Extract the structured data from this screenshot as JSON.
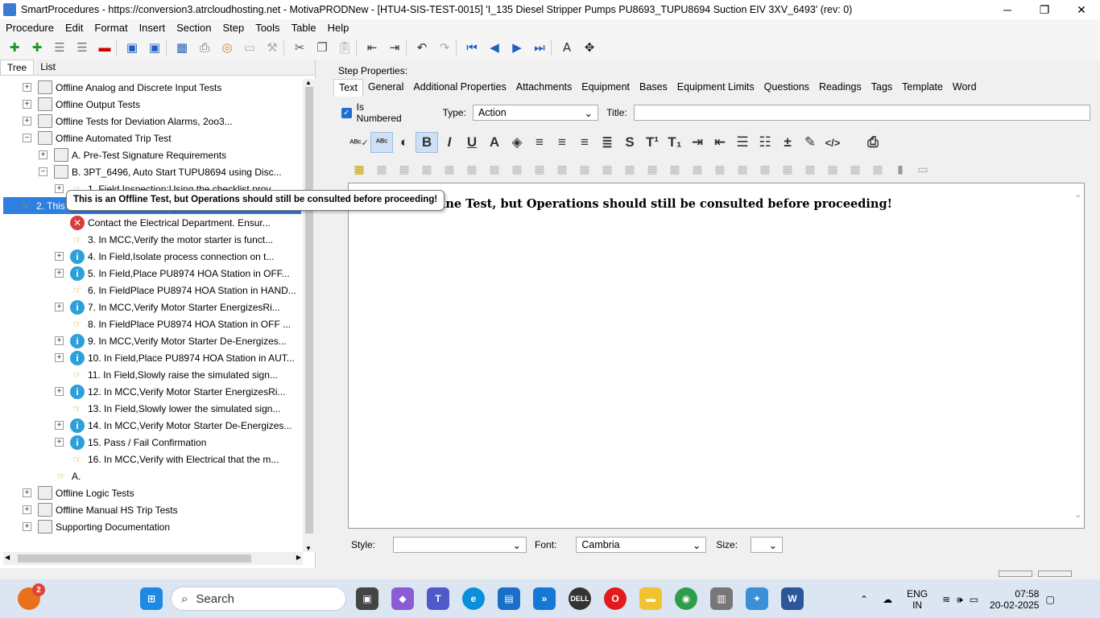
{
  "window": {
    "title": "SmartProcedures - https://conversion3.atrcloudhosting.net - MotivaPRODNew - [HTU4-SIS-TEST-0015] 'I_135 Diesel Stripper Pumps PU8693_TUPU8694 Suction EIV 3XV_6493' (rev: 0)",
    "minimize": "─",
    "maximize": "❐",
    "close": "✕"
  },
  "menu": [
    "Procedure",
    "Edit",
    "Format",
    "Insert",
    "Section",
    "Step",
    "Tools",
    "Table",
    "Help"
  ],
  "left_tabs": [
    "Tree",
    "List"
  ],
  "tree": [
    {
      "label": "Offline Analog and Discrete Input Tests",
      "level": 1,
      "exp": "+",
      "icon": "doc"
    },
    {
      "label": "Offline Output Tests",
      "level": 1,
      "exp": "+",
      "icon": "doc"
    },
    {
      "label": "Offline Tests for Deviation Alarms, 2oo3...",
      "level": 1,
      "exp": "+",
      "icon": "doc"
    },
    {
      "label": "Offline Automated Trip Test",
      "level": 1,
      "exp": "−",
      "icon": "doc"
    },
    {
      "label": "A. Pre-Test Signature Requirements",
      "level": 2,
      "exp": "+",
      "icon": "doc"
    },
    {
      "label": "B. 3PT_6496, Auto Start TUPU8694 using Disc...",
      "level": 2,
      "exp": "−",
      "icon": "doc"
    },
    {
      "label": "1. Field Inspection:Using the checklist prov...",
      "level": 3,
      "exp": "+",
      "icon": "hand"
    },
    {
      "label": "2. This is an Offline Test, but Operations ...",
      "level": 3,
      "exp": "",
      "icon": "hand",
      "selected": true
    },
    {
      "label": "Contact the Electrical Department. Ensur...",
      "level": 3,
      "exp": "",
      "icon": "err"
    },
    {
      "label": "3. In MCC,Verify the motor starter is funct...",
      "level": 3,
      "exp": "",
      "icon": "hand"
    },
    {
      "label": "4. In Field,Isolate process connection on t...",
      "level": 3,
      "exp": "+",
      "icon": "info"
    },
    {
      "label": "5. In Field,Place PU8974 HOA Station in OFF...",
      "level": 3,
      "exp": "+",
      "icon": "info"
    },
    {
      "label": "6. In FieldPlace PU8974 HOA Station in HAND...",
      "level": 3,
      "exp": "",
      "icon": "hand"
    },
    {
      "label": "7. In MCC,Verify Motor Starter EnergizesRi...",
      "level": 3,
      "exp": "+",
      "icon": "info"
    },
    {
      "label": "8. In FieldPlace PU8974 HOA Station in OFF ...",
      "level": 3,
      "exp": "",
      "icon": "hand"
    },
    {
      "label": "9. In MCC,Verify Motor Starter De-Energizes...",
      "level": 3,
      "exp": "+",
      "icon": "info"
    },
    {
      "label": "10. In Field,Place PU8974 HOA Station in AUT...",
      "level": 3,
      "exp": "+",
      "icon": "info"
    },
    {
      "label": "11. In Field,Slowly raise the simulated sign...",
      "level": 3,
      "exp": "",
      "icon": "hand"
    },
    {
      "label": "12. In MCC,Verify Motor Starter EnergizesRi...",
      "level": 3,
      "exp": "+",
      "icon": "info"
    },
    {
      "label": "13. In Field,Slowly lower the simulated sign...",
      "level": 3,
      "exp": "",
      "icon": "hand"
    },
    {
      "label": "14. In MCC,Verify Motor Starter De-Energizes...",
      "level": 3,
      "exp": "+",
      "icon": "info"
    },
    {
      "label": "15. Pass / Fail Confirmation",
      "level": 3,
      "exp": "+",
      "icon": "info"
    },
    {
      "label": "16. In MCC,Verify with Electrical that the m...",
      "level": 3,
      "exp": "",
      "icon": "hand"
    },
    {
      "label": "A.",
      "level": 2,
      "exp": "",
      "icon": "hand"
    },
    {
      "label": "Offline Logic Tests",
      "level": 1,
      "exp": "+",
      "icon": "doc"
    },
    {
      "label": "Offline Manual HS Trip Tests",
      "level": 1,
      "exp": "+",
      "icon": "doc"
    },
    {
      "label": "Supporting Documentation",
      "level": 1,
      "exp": "+",
      "icon": "doc"
    }
  ],
  "tooltip": "This is an Offline Test, but Operations should still be consulted before proceeding!",
  "step_properties": {
    "label": "Step Properties:",
    "tabs": [
      "Text",
      "General",
      "Additional Properties",
      "Attachments",
      "Equipment",
      "Bases",
      "Equipment Limits",
      "Questions",
      "Readings",
      "Tags",
      "Template",
      "Word"
    ],
    "is_numbered": "Is Numbered",
    "type_label": "Type:",
    "type_value": "Action",
    "title_label": "Title:",
    "title_value": ""
  },
  "editor": {
    "content": "Offline Test, but Operations should still be consulted before proceeding!",
    "content_prefix": "is an"
  },
  "bottom": {
    "style_label": "Style:",
    "style_value": "",
    "font_label": "Font:",
    "font_value": "Cambria",
    "size_label": "Size:",
    "size_value": ""
  },
  "taskbar": {
    "search_placeholder": "Search",
    "badge": "2",
    "lang": "ENG",
    "region": "IN",
    "time": "07:58",
    "date": "20-02-2025"
  }
}
